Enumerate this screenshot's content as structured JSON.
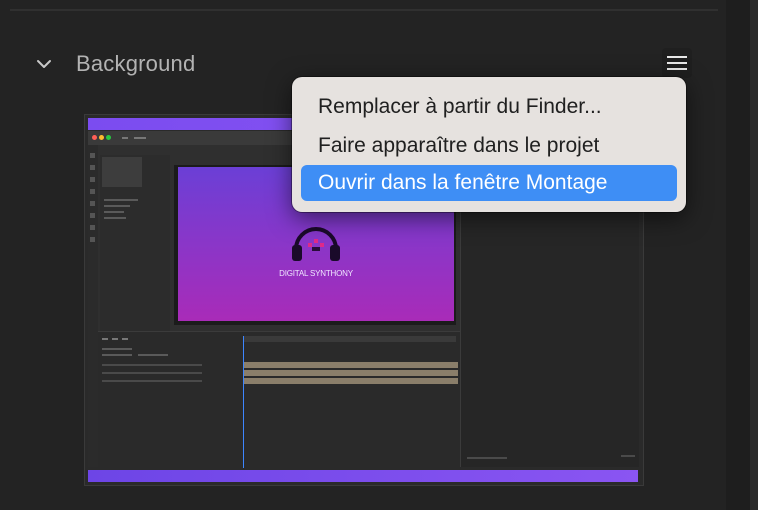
{
  "panel": {
    "section_title": "Background",
    "expanded": true
  },
  "icons": {
    "expand": "chevron-down-icon",
    "menu": "hamburger-menu-icon"
  },
  "thumbnail": {
    "composition_text": "DIGITAL SYNTHONY"
  },
  "context_menu": {
    "items": [
      {
        "label": "Remplacer à partir du Finder..."
      },
      {
        "label": "Faire apparaître dans le projet"
      },
      {
        "label": "Ouvrir dans la fenêtre Montage",
        "highlighted": true
      }
    ]
  },
  "colors": {
    "panel_bg": "#232323",
    "menu_bg": "#e6e2df",
    "menu_highlight": "#3e8ef5",
    "accent_purple": "#8a55f2"
  }
}
